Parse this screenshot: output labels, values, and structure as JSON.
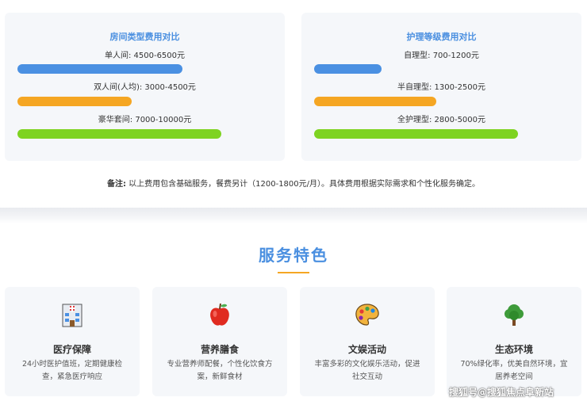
{
  "room_costs": {
    "title": "房间类型费用对比",
    "rows": [
      {
        "label": "单人间: 4500-6500元",
        "color": "#4a90e2",
        "fill": 0.81
      },
      {
        "label": "双人间(人均): 3000-4500元",
        "color": "#f5a623",
        "fill": 0.56
      },
      {
        "label": "豪华套间: 7000-10000元",
        "color": "#7ed321",
        "fill": 1.0
      }
    ]
  },
  "care_costs": {
    "title": "护理等级费用对比",
    "rows": [
      {
        "label": "自理型: 700-1200元",
        "color": "#4a90e2",
        "fill": 0.33
      },
      {
        "label": "半自理型: 1300-2500元",
        "color": "#f5a623",
        "fill": 0.6
      },
      {
        "label": "全护理型: 2800-5000元",
        "color": "#7ed321",
        "fill": 1.0
      }
    ]
  },
  "note": {
    "prefix": "备注:",
    "text": "以上费用包含基础服务，餐费另计（1200-1800元/月）。具体费用根据实际需求和个性化服务确定。"
  },
  "services": {
    "title": "服务特色",
    "accent_color": "#f5a623",
    "items": [
      {
        "icon": "hospital-icon",
        "name": "医疗保障",
        "desc": "24小时医护值班，定期健康检查，紧急医疗响应"
      },
      {
        "icon": "apple-icon",
        "name": "营养膳食",
        "desc": "专业营养师配餐，个性化饮食方案，新鲜食材"
      },
      {
        "icon": "palette-icon",
        "name": "文娱活动",
        "desc": "丰富多彩的文化娱乐活动，促进社交互动"
      },
      {
        "icon": "tree-icon",
        "name": "生态环境",
        "desc": "70%绿化率，优美自然环境，宜居养老空间"
      }
    ]
  },
  "watermark": "搜狐号@搜狐焦点阜新站"
}
